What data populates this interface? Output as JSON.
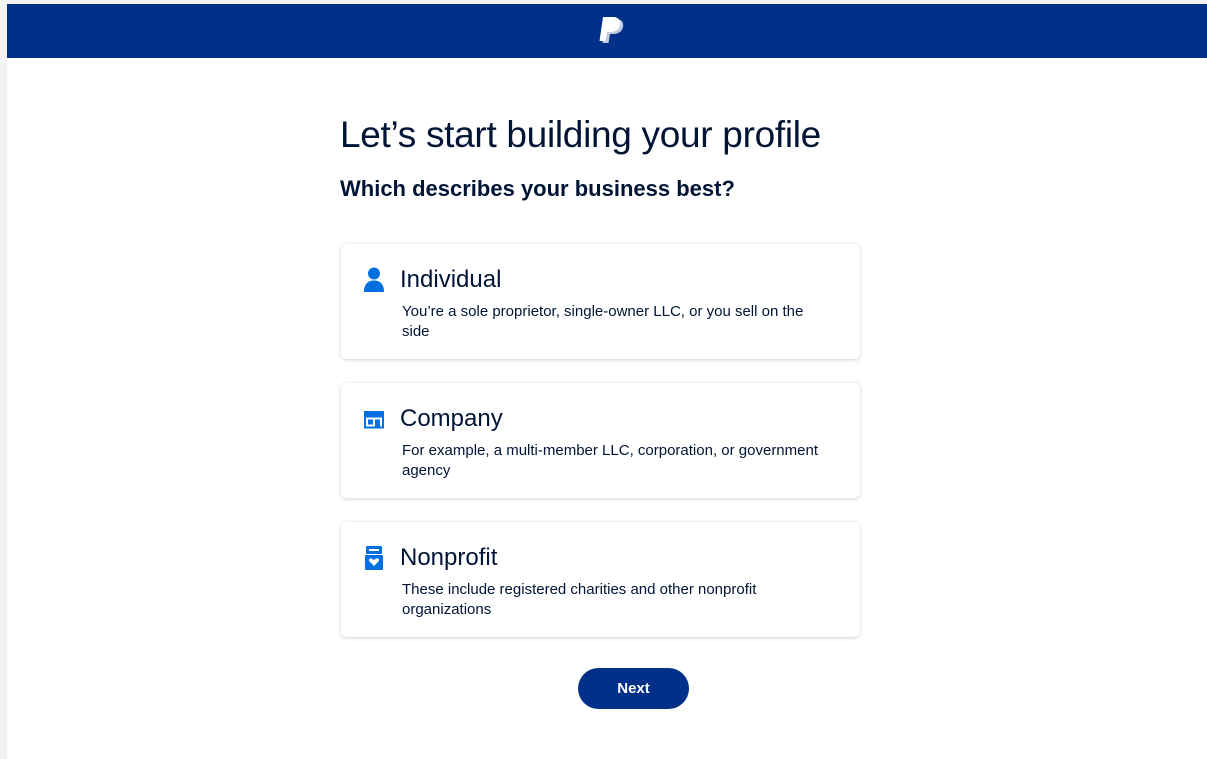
{
  "header": {
    "logo_icon": "paypal-logo",
    "background": "#003087"
  },
  "main": {
    "title": "Let’s start building your profile",
    "subtitle": "Which describes your business best?",
    "options": [
      {
        "icon": "person-icon",
        "title": "Individual",
        "description": "You’re a sole proprietor, single-owner LLC, or you sell on the side"
      },
      {
        "icon": "storefront-icon",
        "title": "Company",
        "description": "For example, a multi-member LLC, corporation, or government agency"
      },
      {
        "icon": "charity-icon",
        "title": "Nonprofit",
        "description": "These include registered charities and other nonprofit organizations"
      }
    ],
    "next_label": "Next"
  },
  "colors": {
    "brand_dark": "#003087",
    "icon_blue": "#0070e0",
    "text": "#001435"
  }
}
